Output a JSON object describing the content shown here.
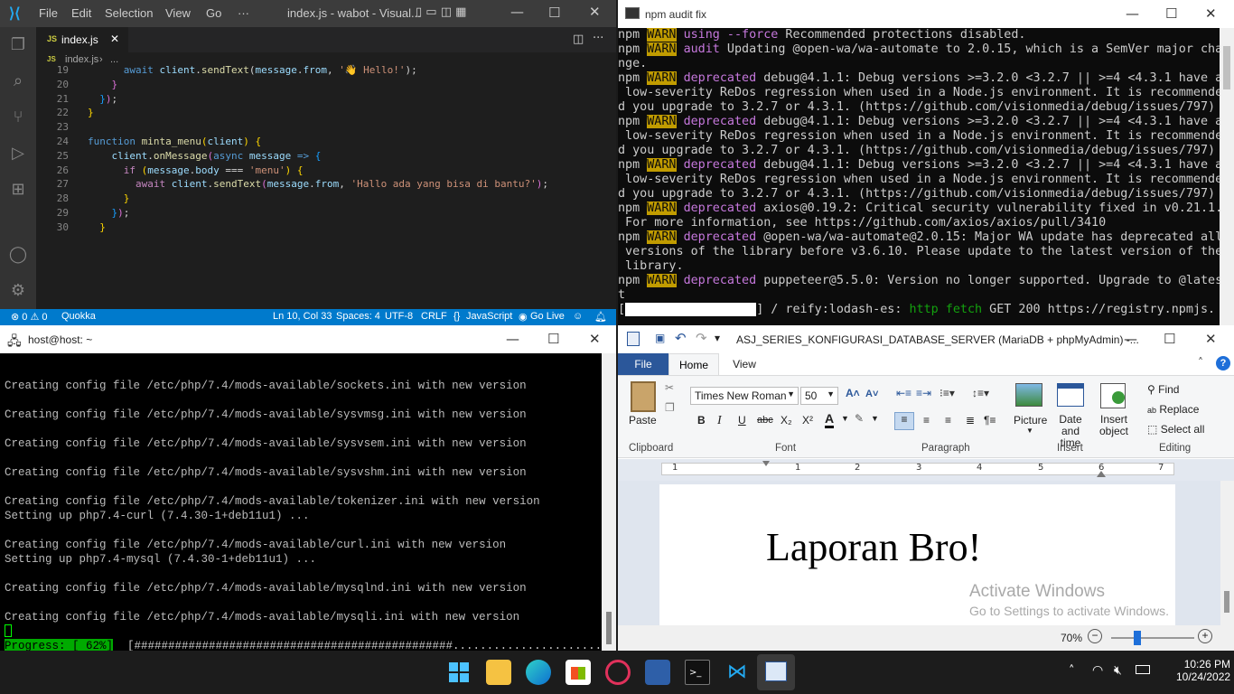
{
  "vscode": {
    "menu": [
      "File",
      "Edit",
      "Selection",
      "View",
      "Go",
      "···"
    ],
    "title": "index.js - wabot - Visual...",
    "tab": "index.js",
    "breadcrumb_file": "index.js",
    "breadcrumb_more": "...",
    "lines": [
      {
        "n": "19",
        "html": "      <span class='kw'>await</span> <span class='vr'>client</span>.<span class='fn'>sendText</span>(<span class='vr'>message</span>.<span class='vr'>from</span>, <span class='st'>'👋 Hello!'</span>);"
      },
      {
        "n": "20",
        "html": "    <span class='br2'>}</span>"
      },
      {
        "n": "21",
        "html": "  <span class='br3'>}</span><span class='br2'>)</span>;"
      },
      {
        "n": "22",
        "html": "<span class='br'>}</span>"
      },
      {
        "n": "23",
        "html": ""
      },
      {
        "n": "24",
        "html": "<span class='kw'>function</span> <span class='fn'>minta_menu</span><span class='br'>(</span><span class='vr'>client</span><span class='br'>)</span> <span class='br'>{</span>"
      },
      {
        "n": "25",
        "html": "    <span class='vr'>client</span>.<span class='fn'>onMessage</span><span class='br2'>(</span><span class='kw'>async</span> <span class='vr'>message</span> <span class='kw'>=&gt;</span> <span class='br3'>{</span>"
      },
      {
        "n": "26",
        "html": "      <span class='ck'>if</span> <span class='br'>(</span><span class='vr'>message</span>.<span class='vr'>body</span> === <span class='st'>'menu'</span><span class='br'>)</span> <span class='br'>{</span>"
      },
      {
        "n": "27",
        "html": "        <span class='ck'>await</span> <span class='vr'>client</span>.<span class='fn'>sendText</span><span class='br2'>(</span><span class='vr'>message</span>.<span class='vr'>from</span>, <span class='st'>'Hallo ada yang bisa di bantu?'</span><span class='br2'>)</span>;"
      },
      {
        "n": "28",
        "html": "      <span class='br'>}</span>"
      },
      {
        "n": "29",
        "html": "    <span class='br3'>}</span><span class='br2'>)</span>;"
      },
      {
        "n": "30",
        "html": "  <span class='br'>}</span>"
      }
    ],
    "status": {
      "errors": "0",
      "warnings": "0",
      "quokka": "Quokka",
      "position": "Ln 10, Col 33",
      "spaces": "Spaces: 4",
      "encoding": "UTF-8",
      "eol": "CRLF",
      "language": "JavaScript",
      "golive": "Go Live"
    }
  },
  "npm": {
    "title": "npm audit fix",
    "lines": [
      "npm <w>WARN</w> <m>using --force</m> Recommended protections disabled.",
      "npm <w>WARN</w> <m>audit</m> Updating @open-wa/wa-automate to 2.0.15, which is a SemVer major cha",
      "nge.",
      "npm <w>WARN</w> <m>deprecated</m> debug@4.1.1: Debug versions >=3.2.0 <3.2.7 || >=4 <4.3.1 have a",
      " low-severity ReDos regression when used in a Node.js environment. It is recommende",
      "d you upgrade to 3.2.7 or 4.3.1. (https://github.com/visionmedia/debug/issues/797)",
      "npm <w>WARN</w> <m>deprecated</m> debug@4.1.1: Debug versions >=3.2.0 <3.2.7 || >=4 <4.3.1 have a",
      " low-severity ReDos regression when used in a Node.js environment. It is recommende",
      "d you upgrade to 3.2.7 or 4.3.1. (https://github.com/visionmedia/debug/issues/797)",
      "npm <w>WARN</w> <m>deprecated</m> debug@4.1.1: Debug versions >=3.2.0 <3.2.7 || >=4 <4.3.1 have a",
      " low-severity ReDos regression when used in a Node.js environment. It is recommende",
      "d you upgrade to 3.2.7 or 4.3.1. (https://github.com/visionmedia/debug/issues/797)",
      "npm <w>WARN</w> <m>deprecated</m> axios@0.19.2: Critical security vulnerability fixed in v0.21.1.",
      " For more information, see https://github.com/axios/axios/pull/3410",
      "npm <w>WARN</w> <m>deprecated</m> @open-wa/wa-automate@2.0.15: Major WA update has deprecated all",
      " versions of the library before v3.6.10. Please update to the latest version of the",
      " library.",
      "npm <w>WARN</w> <m>deprecated</m> puppeteer@5.5.0: Version no longer supported. Upgrade to @lates",
      "t",
      "[<b class='bar'>                  </b>] / reify:lodash-es: <g>http fetch</g> GET 200 https://registry.npmjs."
    ]
  },
  "putty": {
    "title": "host@host: ~",
    "lines": [
      "",
      "Creating config file /etc/php/7.4/mods-available/sockets.ini with new version",
      "",
      "Creating config file /etc/php/7.4/mods-available/sysvmsg.ini with new version",
      "",
      "Creating config file /etc/php/7.4/mods-available/sysvsem.ini with new version",
      "",
      "Creating config file /etc/php/7.4/mods-available/sysvshm.ini with new version",
      "",
      "Creating config file /etc/php/7.4/mods-available/tokenizer.ini with new version",
      "Setting up php7.4-curl (7.4.30-1+deb11u1) ...",
      "",
      "Creating config file /etc/php/7.4/mods-available/curl.ini with new version",
      "Setting up php7.4-mysql (7.4.30-1+deb11u1) ...",
      "",
      "Creating config file /etc/php/7.4/mods-available/mysqlnd.ini with new version",
      "",
      "Creating config file /etc/php/7.4/mods-available/mysqli.ini with new version"
    ],
    "progress_label": "Progress: [ 62%]",
    "progress_bar": "[###############################################.......................]",
    "progress": 0.62
  },
  "wordpad": {
    "title": "ASJ_SERIES_KONFIGURASI_DATABASE_SERVER (MariaDB + phpMyAdmin) -...",
    "tabs": [
      "File",
      "Home",
      "View"
    ],
    "font": "Times New Roman",
    "size": "50",
    "groups": [
      "Clipboard",
      "Font",
      "Paragraph",
      "Insert",
      "Editing"
    ],
    "paste": "Paste",
    "picture": "Picture",
    "datetime1": "Date and",
    "datetime2": "time",
    "insert1": "Insert",
    "insert2": "object",
    "find": "Find",
    "replace": "Replace",
    "selectall": "Select all",
    "ruler": [
      "1",
      "1",
      "2",
      "3",
      "4",
      "5",
      "6",
      "7"
    ],
    "doc_text": "Laporan Bro!",
    "wm1": "Activate Windows",
    "wm2": "Go to Settings to activate Windows.",
    "zoom": "70%"
  },
  "taskbar": {
    "time": "10:26 PM",
    "date": "10/24/2022"
  }
}
